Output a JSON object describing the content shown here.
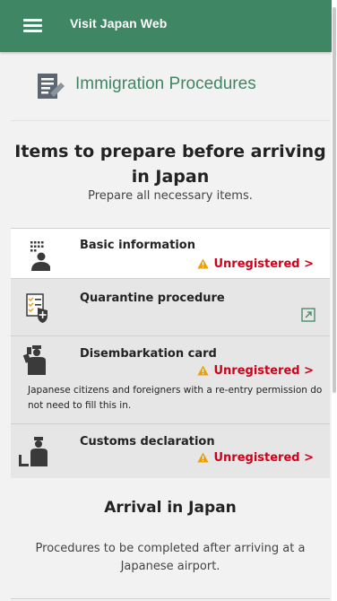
{
  "header": {
    "title": "Visit Japan Web",
    "menu_icon": "hamburger-menu-icon",
    "color": "#3f8665"
  },
  "section": {
    "title": "Immigration Procedures",
    "icon": "immigration-document-icon"
  },
  "prepare": {
    "title": "Items to prepare before arriving in Japan",
    "subtitle": "Prepare all necessary items."
  },
  "items": [
    {
      "label": "Basic information",
      "status": "Unregistered >",
      "icon": "person-keypad-icon"
    },
    {
      "label": "Quarantine procedure",
      "icon": "quarantine-checklist-icon",
      "action_icon": "external-link-icon"
    },
    {
      "label": "Disembarkation card",
      "status": "Unregistered >",
      "icon": "immigration-officer-icon",
      "note": "Japanese citizens and foreigners with a re-entry permission do not need to fill this in."
    },
    {
      "label": "Customs declaration",
      "status": "Unregistered >",
      "icon": "customs-officer-icon"
    }
  ],
  "arrival": {
    "title": "Arrival in Japan",
    "description": "Procedures to be completed after arriving at a Japanese airport."
  },
  "colors": {
    "warning": "#f0a000",
    "status_text": "#d0021b",
    "accent": "#3f8665"
  }
}
